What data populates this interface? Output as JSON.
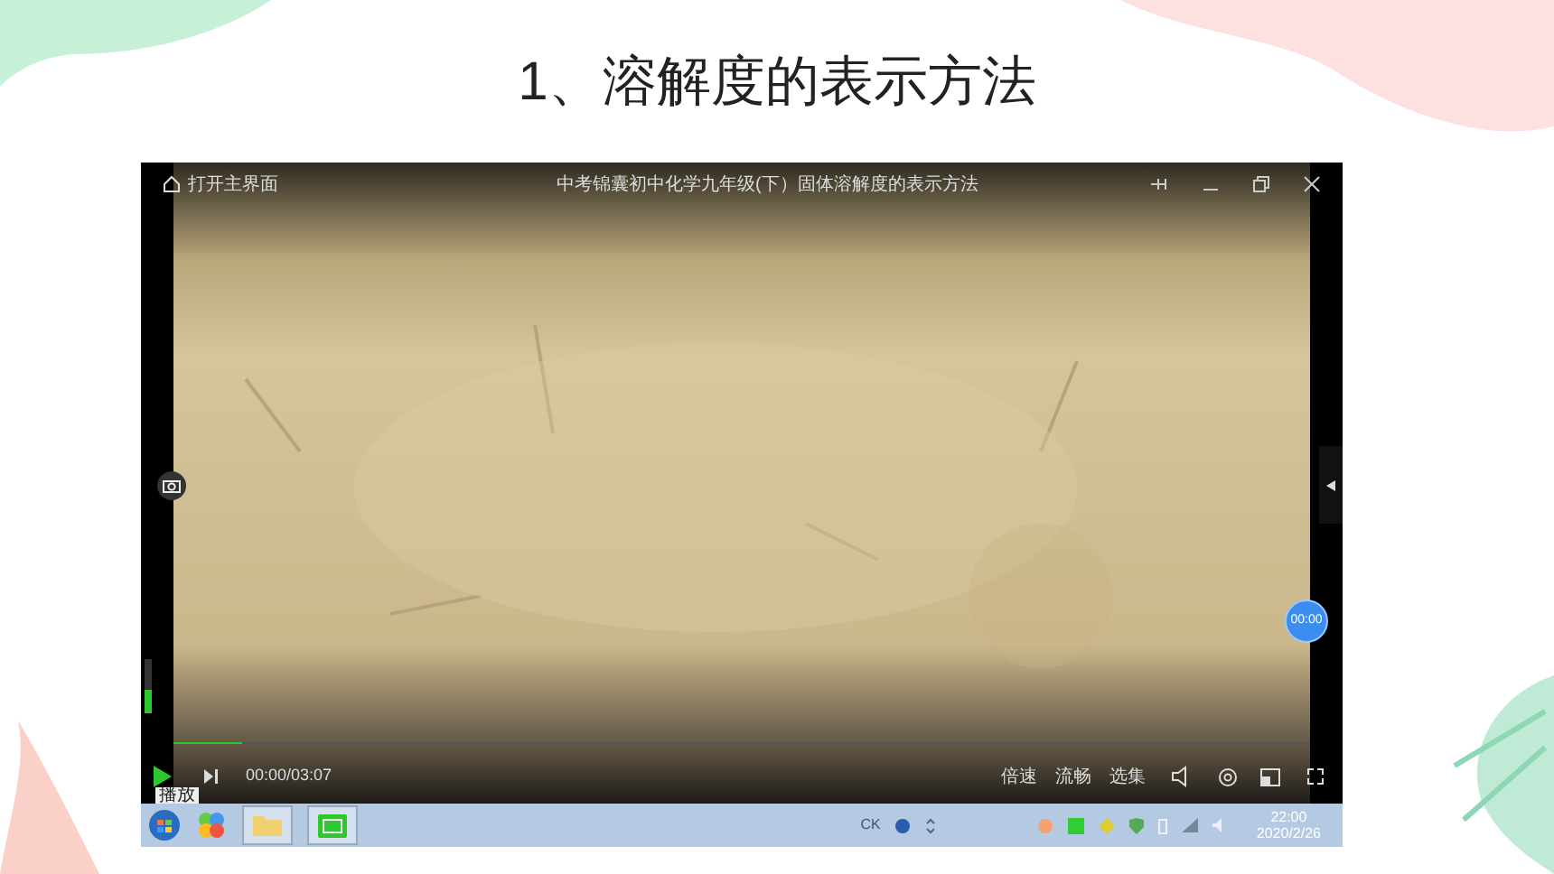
{
  "slide": {
    "title": "1、溶解度的表示方法"
  },
  "player": {
    "home_label": "打开主界面",
    "title": "中考锦囊初中化学九年级(下）固体溶解度的表示方法",
    "volume": {
      "level": 0.45
    },
    "seek_bar": {
      "level": 0.06
    },
    "time": "00:00/03:07",
    "timer_badge": "00:00",
    "tooltip": "播放",
    "controls": [
      {
        "label": "倍速"
      },
      {
        "label": "流畅"
      },
      {
        "label": "选集"
      }
    ]
  },
  "taskbar": {
    "tray_text": "CK",
    "time": "22:00",
    "date": "2020/2/26"
  }
}
